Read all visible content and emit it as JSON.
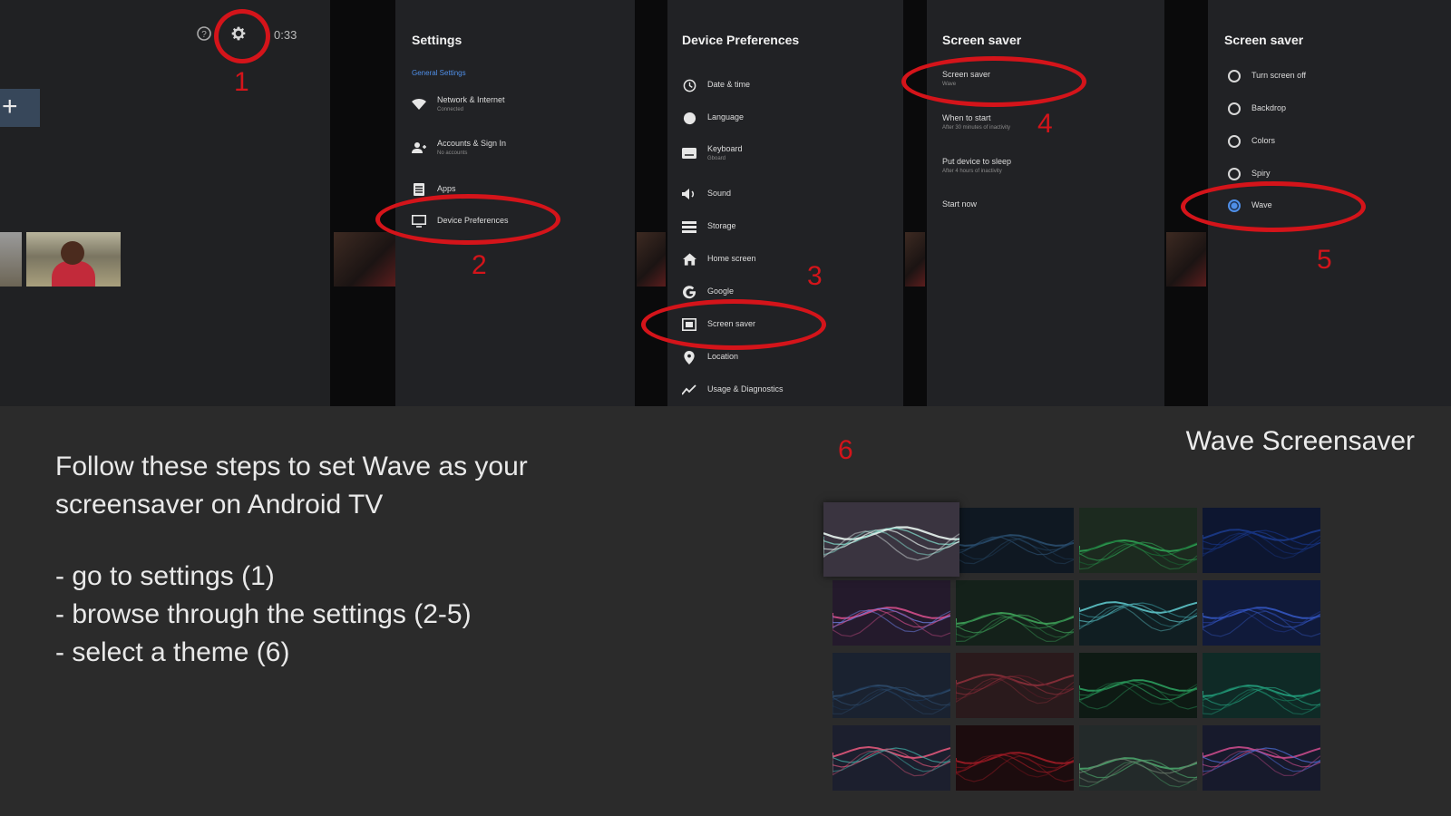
{
  "panels": {
    "home": {
      "clock": "0:33",
      "step": "1"
    },
    "settings": {
      "title": "Settings",
      "subhead": "General Settings",
      "items": [
        {
          "label": "Network & Internet",
          "sub": "Connected",
          "icon": "wifi-icon"
        },
        {
          "label": "Accounts & Sign In",
          "sub": "No accounts",
          "icon": "accounts-icon"
        },
        {
          "label": "Apps",
          "sub": "",
          "icon": "apps-icon"
        },
        {
          "label": "Device Preferences",
          "sub": "",
          "icon": "tv-icon"
        }
      ],
      "step": "2"
    },
    "device_prefs": {
      "title": "Device Preferences",
      "items": [
        {
          "label": "Date & time",
          "sub": "",
          "icon": "clock-icon"
        },
        {
          "label": "Language",
          "sub": "",
          "icon": "globe-icon"
        },
        {
          "label": "Keyboard",
          "sub": "Gboard",
          "icon": "keyboard-icon"
        },
        {
          "label": "Sound",
          "sub": "",
          "icon": "sound-icon"
        },
        {
          "label": "Storage",
          "sub": "",
          "icon": "storage-icon"
        },
        {
          "label": "Home screen",
          "sub": "",
          "icon": "home-icon"
        },
        {
          "label": "Google",
          "sub": "",
          "icon": "google-icon"
        },
        {
          "label": "Screen saver",
          "sub": "",
          "icon": "screensaver-icon"
        },
        {
          "label": "Location",
          "sub": "",
          "icon": "location-icon"
        },
        {
          "label": "Usage & Diagnostics",
          "sub": "",
          "icon": "diagnostics-icon"
        }
      ],
      "step": "3"
    },
    "screensaver": {
      "title": "Screen saver",
      "items": [
        {
          "label": "Screen saver",
          "sub": "Wave"
        },
        {
          "label": "When to start",
          "sub": "After 30 minutes of inactivity"
        },
        {
          "label": "Put device to sleep",
          "sub": "After 4 hours of inactivity"
        },
        {
          "label": "Start now",
          "sub": ""
        }
      ],
      "step": "4"
    },
    "screensaver_options": {
      "title": "Screen saver",
      "options": [
        {
          "label": "Turn screen off",
          "selected": false
        },
        {
          "label": "Backdrop",
          "selected": false
        },
        {
          "label": "Colors",
          "selected": false
        },
        {
          "label": "Spiry",
          "selected": false
        },
        {
          "label": "Wave",
          "selected": true
        }
      ],
      "step": "5"
    }
  },
  "bottom": {
    "intro": "Follow these steps to set Wave as your screensaver on Android TV",
    "steps": [
      "- go to settings (1)",
      "- browse through the settings (2-5)",
      "- select a theme (6)"
    ],
    "gallery_title": "Wave Screensaver",
    "gallery_step": "6",
    "themes": [
      {
        "bg": "#3a3440",
        "stroke": "#e8f4f0",
        "accent": "#7fd3c4"
      },
      {
        "bg": "#0f1822",
        "stroke": "#2a4e6e",
        "accent": "#1e3a55"
      },
      {
        "bg": "#1c2a1f",
        "stroke": "#2f9e52",
        "accent": "#1a6b36"
      },
      {
        "bg": "#0d1630",
        "stroke": "#1b3a8a",
        "accent": "#14307a"
      },
      {
        "bg": "#241a2c",
        "stroke": "#d34e8a",
        "accent": "#6c7de0"
      },
      {
        "bg": "#14211a",
        "stroke": "#3fa35a",
        "accent": "#2c7a44"
      },
      {
        "bg": "#101e22",
        "stroke": "#5dc3c8",
        "accent": "#2e7b82"
      },
      {
        "bg": "#101a3a",
        "stroke": "#3457c0",
        "accent": "#22398a"
      },
      {
        "bg": "#1a2230",
        "stroke": "#2d4a6a",
        "accent": "#1c3350"
      },
      {
        "bg": "#2a1a1c",
        "stroke": "#8a2f3a",
        "accent": "#5a1e28"
      },
      {
        "bg": "#0e1a14",
        "stroke": "#2b9c5d",
        "accent": "#1d6a3f"
      },
      {
        "bg": "#0f2a26",
        "stroke": "#23a07e",
        "accent": "#177055"
      },
      {
        "bg": "#1c1f2e",
        "stroke": "#e0567a",
        "accent": "#3fa6a0"
      },
      {
        "bg": "#1c0c0e",
        "stroke": "#a11c26",
        "accent": "#6e1219"
      },
      {
        "bg": "#232a2a",
        "stroke": "#4aa36a",
        "accent": "#6a7a6a"
      },
      {
        "bg": "#171a2c",
        "stroke": "#c84a8a",
        "accent": "#4a6ad0"
      }
    ]
  }
}
